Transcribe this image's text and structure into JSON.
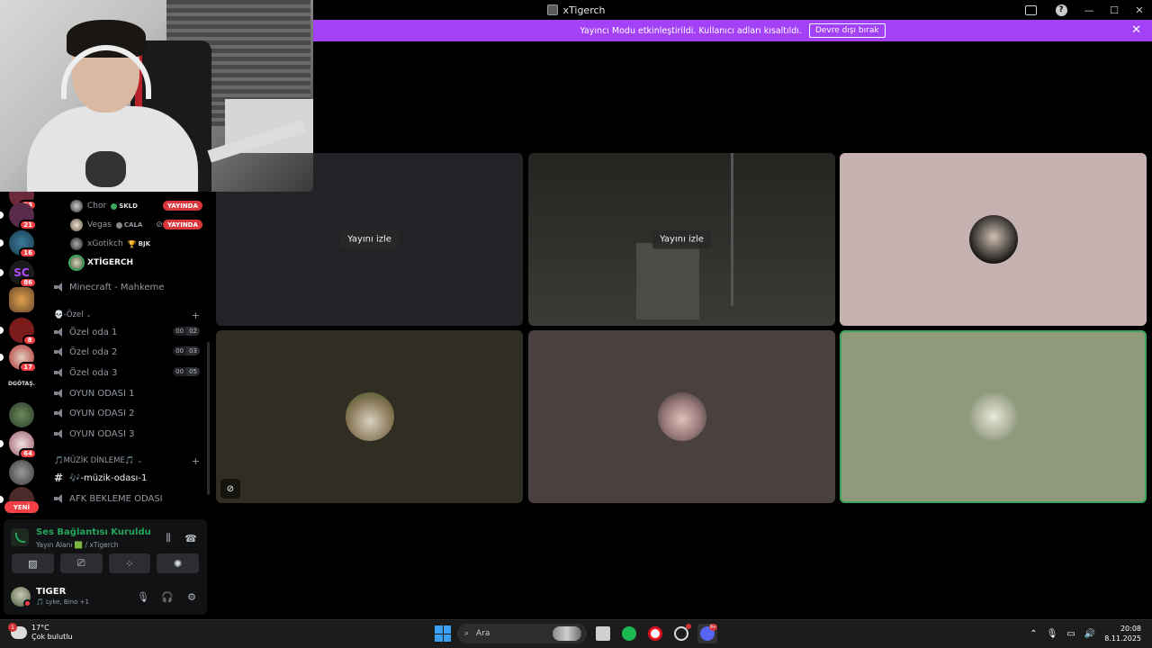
{
  "window": {
    "title": "xTigerch"
  },
  "banner": {
    "text": "Yayıncı Modu etkinleştirildi. Kullanıcı adları kısaltıldı.",
    "button_label": "Devre dışı bırak",
    "close_label": "✕"
  },
  "rail": {
    "badges": [
      "13",
      "21",
      "16",
      "86",
      "8",
      "17",
      "64"
    ],
    "text_server": "DGÖTAŞ.",
    "new_label": "YENİ"
  },
  "voice_users": [
    {
      "name": "Chor",
      "tag": "SKLD",
      "live": "YAYINDA"
    },
    {
      "name": "Vegas",
      "tag": "CALA",
      "live": "YAYINDA"
    },
    {
      "name": "xGotikch",
      "tag": "BJK"
    },
    {
      "name": "XTİGERCH"
    }
  ],
  "channels": {
    "minecraft": "Minecraft - Mahkeme",
    "ozel_category": "💀-Özel",
    "ozel_1": "Özel oda 1",
    "ozel_1_count": [
      "00",
      "02"
    ],
    "ozel_2": "Özel oda 2",
    "ozel_2_count": [
      "00",
      "03"
    ],
    "ozel_3": "Özel oda 3",
    "ozel_3_count": [
      "00",
      "05"
    ],
    "oyun_1": "OYUN ODASI 1",
    "oyun_2": "OYUN ODASI 2",
    "oyun_3": "OYUN ODASI 3",
    "muzik_category": "🎵MÜZİK DİNLEME🎵",
    "muzik_odasi": "🎶-müzik-odası-1",
    "afk": "AFK BEKLEME ODASI"
  },
  "rtc": {
    "title": "Ses Bağlantısı Kuruldu",
    "subtitle": "Yayın Alanı 🟩 / xTigerch"
  },
  "user": {
    "name": "TIGER",
    "subtitle": "🎵 Lyke, Bino +1"
  },
  "tiles": {
    "watch_label": "Yayını izle"
  },
  "taskbar": {
    "weather_temp": "17°C",
    "weather_desc": "Çok bulutlu",
    "weather_badge": "1",
    "search_placeholder": "Ara",
    "discord_badge": "9+",
    "time": "20:08",
    "date": "8.11.2025"
  },
  "colors": {
    "banner": "#a241f5",
    "live_red": "#da373c",
    "connected_green": "#23a55a",
    "speaking_green": "#3ba55c"
  }
}
